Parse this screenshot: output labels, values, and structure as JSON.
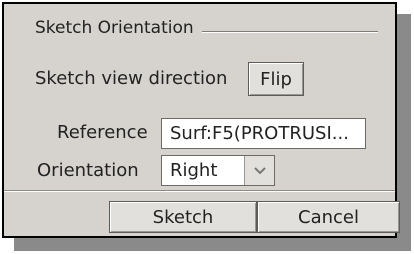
{
  "group": {
    "title": "Sketch Orientation"
  },
  "view_direction": {
    "label": "Sketch view direction",
    "flip_label": "Flip"
  },
  "reference": {
    "label": "Reference",
    "value": "Surf:F5(PROTRUSI..."
  },
  "orientation": {
    "label": "Orientation",
    "value": "Right",
    "arrow_icon": "chevron-down-icon"
  },
  "footer": {
    "sketch_label": "Sketch",
    "cancel_label": "Cancel"
  }
}
